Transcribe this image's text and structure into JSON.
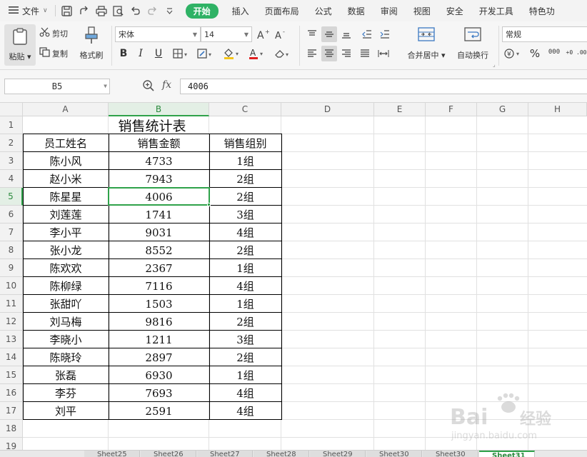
{
  "menu": {
    "file_label": "文件",
    "tabs": [
      "开始",
      "插入",
      "页面布局",
      "公式",
      "数据",
      "审阅",
      "视图",
      "安全",
      "开发工具",
      "特色功"
    ],
    "active_tab": "开始"
  },
  "ribbon": {
    "paste_label": "粘贴",
    "cut_label": "剪切",
    "copy_label": "复制",
    "format_painter_label": "格式刷",
    "font_name": "宋体",
    "font_size": "14",
    "merge_center_label": "合并居中",
    "wrap_text_label": "自动换行",
    "number_format": "常规",
    "percent_symbol": "%",
    "thousands_symbol": "000",
    "decimal_symbol": "+0 .00"
  },
  "formula_bar": {
    "cell_ref": "B5",
    "fx_label": "fx",
    "value": "4006"
  },
  "columns": [
    "A",
    "B",
    "C",
    "D",
    "E",
    "F",
    "G",
    "H"
  ],
  "selected_column": "B",
  "rows": [
    "1",
    "2",
    "3",
    "4",
    "5",
    "6",
    "7",
    "8",
    "9",
    "10",
    "11",
    "12",
    "13",
    "14",
    "15",
    "16",
    "17",
    "18",
    "19"
  ],
  "selected_row": "5",
  "sheet": {
    "title": "销售统计表",
    "headers": [
      "员工姓名",
      "销售金额",
      "销售组别"
    ],
    "records": [
      [
        "陈小风",
        "4733",
        "1组"
      ],
      [
        "赵小米",
        "7943",
        "2组"
      ],
      [
        "陈星星",
        "4006",
        "2组"
      ],
      [
        "刘莲莲",
        "1741",
        "3组"
      ],
      [
        "李小平",
        "9031",
        "4组"
      ],
      [
        "张小龙",
        "8552",
        "2组"
      ],
      [
        "陈欢欢",
        "2367",
        "1组"
      ],
      [
        "陈柳绿",
        "7116",
        "4组"
      ],
      [
        "张甜吖",
        "1503",
        "1组"
      ],
      [
        "刘马梅",
        "9816",
        "2组"
      ],
      [
        "李晓小",
        "1211",
        "3组"
      ],
      [
        "陈晓玲",
        "2897",
        "2组"
      ],
      [
        "张磊",
        "6930",
        "1组"
      ],
      [
        "李芬",
        "7693",
        "4组"
      ],
      [
        "刘平",
        "2591",
        "4组"
      ]
    ]
  },
  "sheet_tabs": [
    "Sheet25",
    "Sheet26",
    "Sheet27",
    "Sheet28",
    "Sheet29",
    "Sheet30",
    "Sheet30",
    "Sheet31"
  ],
  "watermark_text": "Baidu经验 jingyan.baidu.com",
  "colors": {
    "accent": "#2fb265",
    "selection": "#2fa24a"
  }
}
